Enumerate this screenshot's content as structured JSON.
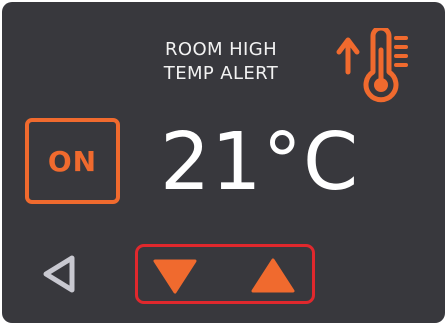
{
  "alert": {
    "line1": "ROOM HIGH",
    "line2": "TEMP ALERT",
    "icon": "thermometer-rising-icon"
  },
  "power_button": {
    "label": "ON"
  },
  "temperature": {
    "display": "21°C"
  },
  "controls": {
    "back_icon": "back-triangle-icon",
    "decrease_icon": "arrow-down-icon",
    "increase_icon": "arrow-up-icon"
  },
  "colors": {
    "background": "#38383d",
    "accent": "#f06a2e",
    "highlight_border": "#e0282d",
    "text": "#ffffff",
    "muted_icon": "#c9c9d1"
  }
}
